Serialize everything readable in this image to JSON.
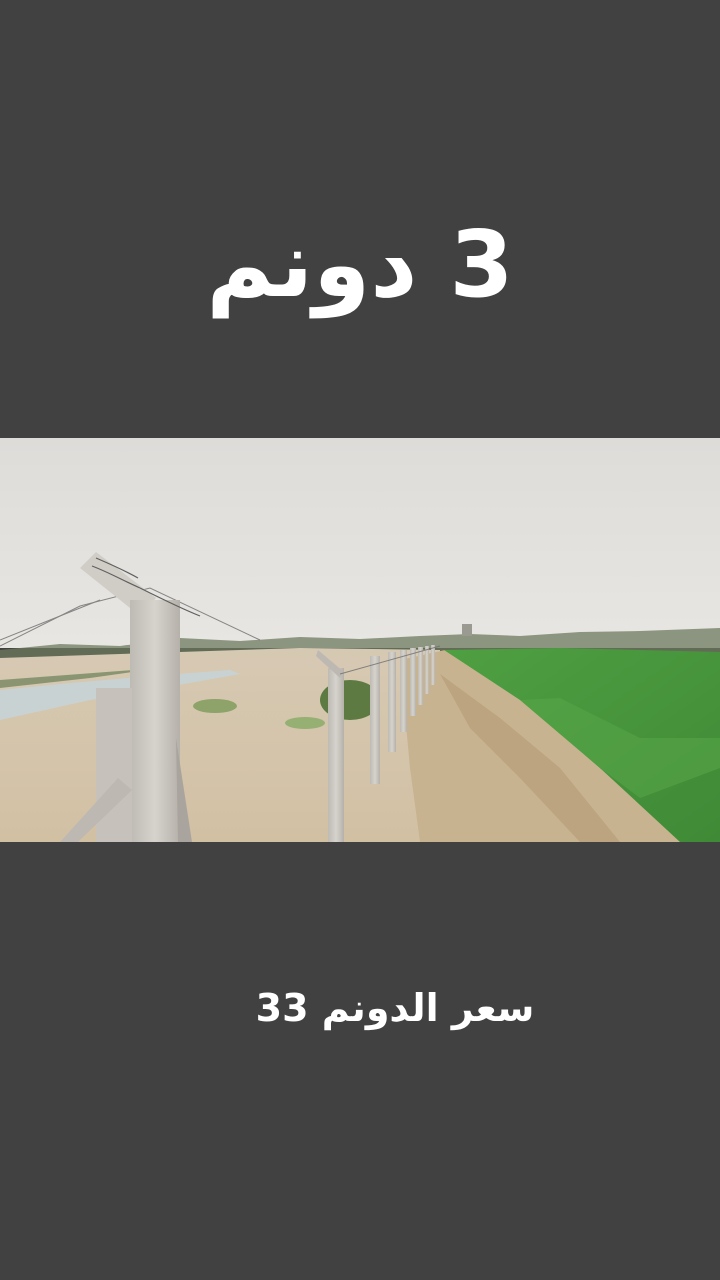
{
  "overlay": {
    "title": "3 دونم",
    "caption": "سعر الدونم 33"
  },
  "photo": {
    "subject": "farmland plot with concrete-post barbed wire fence beside a green field",
    "colors": {
      "sky": "#e2e0dd",
      "sand": "#d9cbb4",
      "field": "#4c9a3d",
      "post": "#cfccc6",
      "background": "#414141"
    }
  }
}
